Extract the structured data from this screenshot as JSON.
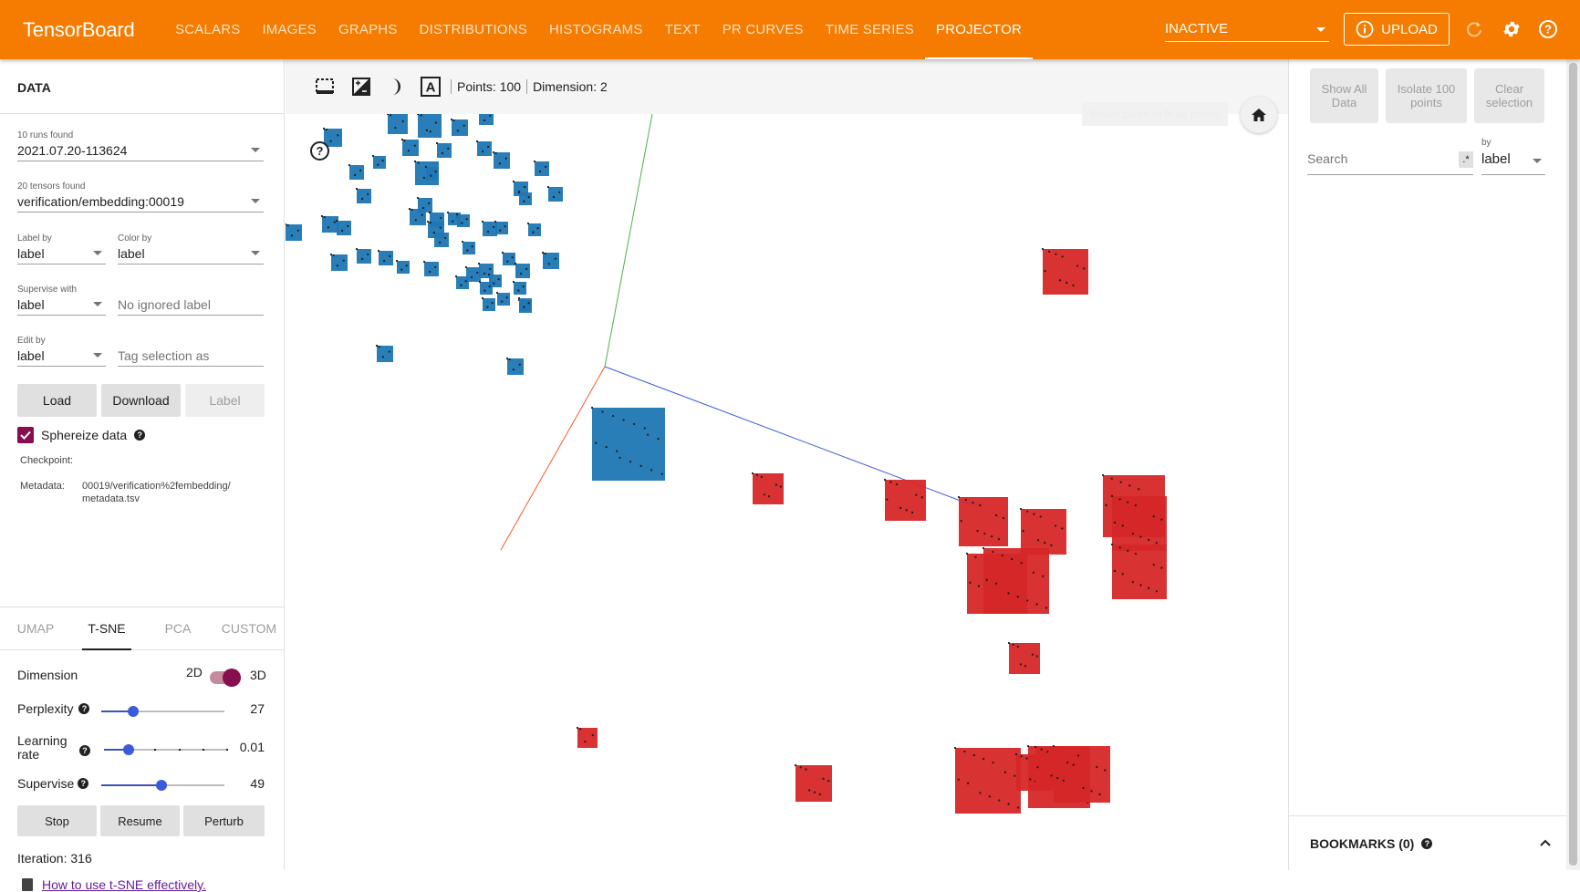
{
  "header": {
    "brand": "TensorBoard",
    "tabs": [
      "SCALARS",
      "IMAGES",
      "GRAPHS",
      "DISTRIBUTIONS",
      "HISTOGRAMS",
      "TEXT",
      "PR CURVES",
      "TIME SERIES",
      "PROJECTOR"
    ],
    "active_tab": "PROJECTOR",
    "run_status": "INACTIVE",
    "upload_label": "UPLOAD",
    "accent_color": "#f57c00"
  },
  "data_panel": {
    "title": "DATA",
    "runs_label": "10 runs found",
    "run_value": "2021.07.20-113624",
    "tensors_label": "20 tensors found",
    "tensor_value": "verification/embedding:00019",
    "label_by_label": "Label by",
    "label_by_value": "label",
    "color_by_label": "Color by",
    "color_by_value": "label",
    "supervise_with_label": "Supervise with",
    "supervise_with_value": "label",
    "ignored_label_placeholder": "No ignored label",
    "edit_by_label": "Edit by",
    "edit_by_value": "label",
    "tag_selection_placeholder": "Tag selection as",
    "load_label": "Load",
    "download_label": "Download",
    "label_button": "Label",
    "sphereize_label": "Sphereize data",
    "checkpoint_label": "Checkpoint:",
    "metadata_label": "Metadata:",
    "metadata_value_1": "00019/verification%2fembedding/",
    "metadata_value_2": "metadata.tsv"
  },
  "projection": {
    "tabs": [
      "UMAP",
      "T-SNE",
      "PCA",
      "CUSTOM"
    ],
    "active_tab": "T-SNE",
    "dimension_label": "Dimension",
    "dim_2d": "2D",
    "dim_3d": "3D",
    "dimension_value": "3D",
    "perplexity_label": "Perplexity",
    "perplexity_value": "27",
    "perplexity_fraction": 0.26,
    "learning_rate_label_1": "Learning",
    "learning_rate_label_2": "rate",
    "learning_rate_value": "0.01",
    "learning_rate_fraction": 0.2,
    "supervise_label": "Supervise",
    "supervise_value": "49",
    "supervise_fraction": 0.49,
    "stop_label": "Stop",
    "resume_label": "Resume",
    "perturb_label": "Perturb",
    "iteration_text": "Iteration: 316",
    "help_link": "How to use t-SNE effectively."
  },
  "toolbar": {
    "points_text": "Points: 100",
    "dimension_text": "Dimension: 2",
    "reset_zoom_tooltip": "Reset zoom to fit all points"
  },
  "inspector": {
    "show_all_1": "Show All",
    "show_all_2": "Data",
    "isolate_1": "Isolate 100",
    "isolate_2": "points",
    "clear_1": "Clear",
    "clear_2": "selection",
    "search_placeholder": "Search",
    "regex_label": ".*",
    "by_label": "by",
    "by_value": "label",
    "bookmarks_label": "BOOKMARKS (0)"
  },
  "colors": {
    "cluster_a": "#1f77b4",
    "cluster_b": "#d62728",
    "axis_x": "#ff5722",
    "axis_y": "#4caf50",
    "axis_z": "#3b5bdb",
    "toggle": "#880e4f"
  }
}
